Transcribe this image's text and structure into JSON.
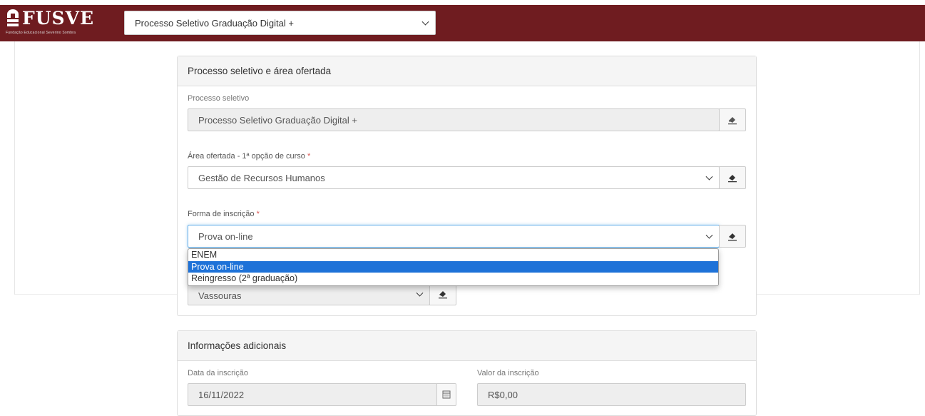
{
  "header": {
    "logo_text": "FUSVE",
    "logo_subtitle": "Fundação Educacional Severino Sombra",
    "process_select_value": "Processo Seletivo Graduação Digital +"
  },
  "panel1": {
    "title": "Processo seletivo e área ofertada",
    "processo_label": "Processo seletivo",
    "processo_value": "Processo Seletivo Graduação Digital +",
    "area_label": "Área ofertada - 1ª opção de curso",
    "area_value": "Gestão de Recursos Humanos",
    "forma_label": "Forma de inscrição",
    "forma_value": "Prova on-line",
    "required_mark": "*",
    "polo_value": "Vassouras",
    "forma_options": [
      "ENEM",
      "Prova on-line",
      "Reingresso (2ª graduação)"
    ]
  },
  "panel2": {
    "title": "Informações adicionais",
    "data_label": "Data da inscrição",
    "data_value": "16/11/2022",
    "valor_label": "Valor da inscrição",
    "valor_value": "R$0,00"
  },
  "colors": {
    "brand": "#6f1c20",
    "selected_option": "#1e72d8",
    "required": "#d9534f"
  },
  "icons": {
    "clear": "eraser-icon",
    "calendar": "calendar-icon",
    "chevron": "chevron-down-icon"
  }
}
